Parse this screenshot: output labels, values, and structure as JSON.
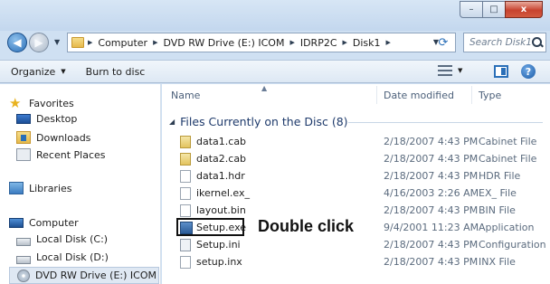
{
  "window": {
    "buttons": {
      "minimize": "–",
      "maximize": "□",
      "close": "x"
    }
  },
  "address": {
    "breadcrumbs": [
      "Computer",
      "DVD RW Drive (E:) ICOM",
      "IDRP2C",
      "Disk1"
    ],
    "search_placeholder": "Search Disk1"
  },
  "toolbar": {
    "organize_label": "Organize",
    "burn_label": "Burn to disc"
  },
  "nav": {
    "favorites": "Favorites",
    "desktop": "Desktop",
    "downloads": "Downloads",
    "recent": "Recent Places",
    "libraries": "Libraries",
    "computer": "Computer",
    "local_c": "Local Disk (C:)",
    "local_d": "Local Disk (D:)",
    "dvd": "DVD RW Drive (E:) ICOM"
  },
  "columns": {
    "name": "Name",
    "date": "Date modified",
    "type": "Type"
  },
  "group": {
    "title": "Files Currently on the Disc (8)"
  },
  "files": [
    {
      "name": "data1.cab",
      "date": "2/18/2007 4:43 PM",
      "type": "Cabinet File"
    },
    {
      "name": "data2.cab",
      "date": "2/18/2007 4:43 PM",
      "type": "Cabinet File"
    },
    {
      "name": "data1.hdr",
      "date": "2/18/2007 4:43 PM",
      "type": "HDR File"
    },
    {
      "name": "ikernel.ex_",
      "date": "4/16/2003 2:26 AM",
      "type": "EX_ File"
    },
    {
      "name": "layout.bin",
      "date": "2/18/2007 4:43 PM",
      "type": "BIN File"
    },
    {
      "name": "Setup.exe",
      "date": "9/4/2001 11:23 AM",
      "type": "Application"
    },
    {
      "name": "Setup.ini",
      "date": "2/18/2007 4:43 PM",
      "type": "Configuration"
    },
    {
      "name": "setup.inx",
      "date": "2/18/2007 4:43 PM",
      "type": "INX File"
    }
  ],
  "annotation": {
    "label": "Double click"
  },
  "icons": {
    "back": "back-arrow-icon",
    "forward": "forward-arrow-icon",
    "search": "search-icon",
    "help": "help-icon"
  }
}
